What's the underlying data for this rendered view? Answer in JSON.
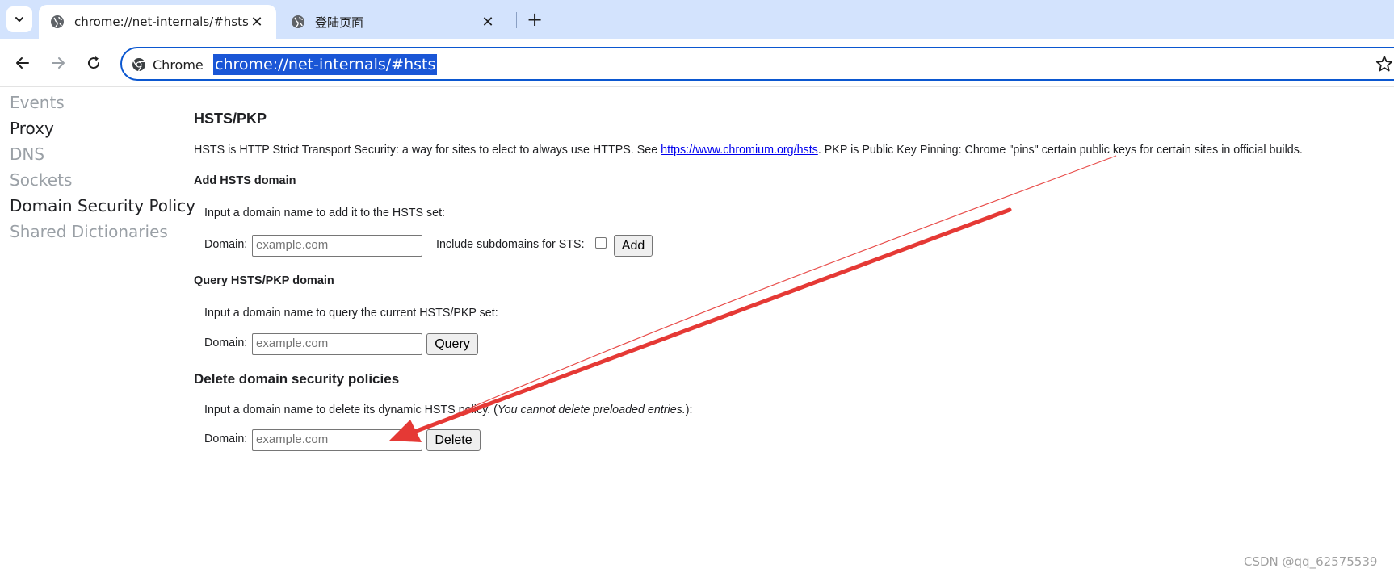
{
  "tabs": [
    {
      "title": "chrome://net-internals/#hsts",
      "icon": "globe-icon",
      "active": true
    },
    {
      "title": "登陆页面",
      "icon": "globe-icon",
      "active": false
    }
  ],
  "omnibox": {
    "chip_label": "Chrome",
    "url": "chrome://net-internals/#hsts"
  },
  "sidebar": {
    "items": [
      {
        "label": "Events",
        "state": "dim"
      },
      {
        "label": "Proxy",
        "state": "on"
      },
      {
        "label": "DNS",
        "state": "dim"
      },
      {
        "label": "Sockets",
        "state": "dim"
      },
      {
        "label": "Domain Security Policy",
        "state": "on"
      },
      {
        "label": "Shared Dictionaries",
        "state": "dim"
      }
    ]
  },
  "main": {
    "title": "HSTS/PKP",
    "description_pre": "HSTS is HTTP Strict Transport Security: a way for sites to elect to always use HTTPS. See ",
    "description_link": "https://www.chromium.org/hsts",
    "description_post": ". PKP is Public Key Pinning: Chrome \"pins\" certain public keys for certain sites in official builds.",
    "add": {
      "heading": "Add HSTS domain",
      "instruction": "Input a domain name to add it to the HSTS set:",
      "domain_label": "Domain:",
      "placeholder": "example.com",
      "subdomains_label": "Include subdomains for STS:",
      "button": "Add"
    },
    "query": {
      "heading": "Query HSTS/PKP domain",
      "instruction": "Input a domain name to query the current HSTS/PKP set:",
      "domain_label": "Domain:",
      "placeholder": "example.com",
      "button": "Query"
    },
    "delete": {
      "heading": "Delete domain security policies",
      "instruction_pre": "Input a domain name to delete its dynamic HSTS policy. (",
      "instruction_italic": "You cannot delete preloaded entries.",
      "instruction_post": "):",
      "domain_label": "Domain:",
      "placeholder": "example.com",
      "button": "Delete"
    }
  },
  "annotation": {
    "arrow_color": "#e53935"
  },
  "watermark": "CSDN @qq_62575539"
}
